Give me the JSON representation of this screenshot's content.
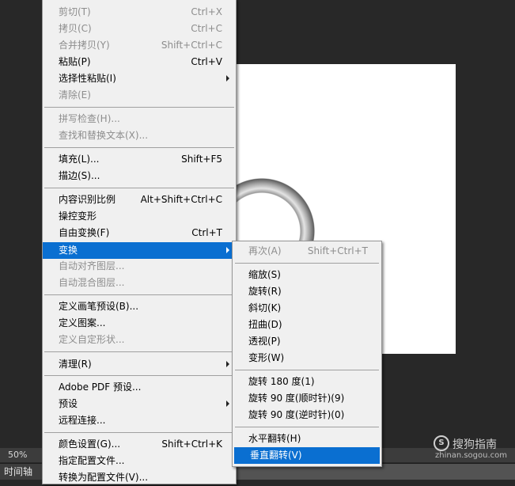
{
  "status": {
    "zoom": "50%"
  },
  "timeline": {
    "tab": "时间轴"
  },
  "watermark": {
    "logo": "S",
    "name": "搜狗指南",
    "url": "zhinan.sogou.com"
  },
  "colors": {
    "highlight": "#0a6fd1",
    "menu_bg": "#f0f0f0",
    "disabled_text": "#8d8d8d",
    "app_bg": "#282828"
  },
  "edit_menu": {
    "items": [
      {
        "label": "剪切(T)",
        "shortcut": "Ctrl+X",
        "disabled": true
      },
      {
        "label": "拷贝(C)",
        "shortcut": "Ctrl+C",
        "disabled": true
      },
      {
        "label": "合并拷贝(Y)",
        "shortcut": "Shift+Ctrl+C",
        "disabled": true
      },
      {
        "label": "粘贴(P)",
        "shortcut": "Ctrl+V"
      },
      {
        "label": "选择性粘贴(I)",
        "submenu": true
      },
      {
        "label": "清除(E)",
        "disabled": true
      },
      {
        "label": "拼写检查(H)...",
        "disabled": true
      },
      {
        "label": "查找和替换文本(X)...",
        "disabled": true
      },
      {
        "label": "填充(L)...",
        "shortcut": "Shift+F5"
      },
      {
        "label": "描边(S)..."
      },
      {
        "label": "内容识别比例",
        "shortcut": "Alt+Shift+Ctrl+C"
      },
      {
        "label": "操控变形"
      },
      {
        "label": "自由变换(F)",
        "shortcut": "Ctrl+T"
      },
      {
        "label": "变换",
        "submenu": true,
        "highlighted": true
      },
      {
        "label": "自动对齐图层...",
        "disabled": true
      },
      {
        "label": "自动混合图层...",
        "disabled": true
      },
      {
        "label": "定义画笔预设(B)..."
      },
      {
        "label": "定义图案..."
      },
      {
        "label": "定义自定形状...",
        "disabled": true
      },
      {
        "label": "清理(R)",
        "submenu": true
      },
      {
        "label": "Adobe PDF 预设..."
      },
      {
        "label": "预设",
        "submenu": true
      },
      {
        "label": "远程连接..."
      },
      {
        "label": "颜色设置(G)...",
        "shortcut": "Shift+Ctrl+K"
      },
      {
        "label": "指定配置文件..."
      },
      {
        "label": "转换为配置文件(V)..."
      }
    ]
  },
  "transform_submenu": {
    "items": [
      {
        "label": "再次(A)",
        "shortcut": "Shift+Ctrl+T",
        "disabled": true
      },
      {
        "label": "缩放(S)"
      },
      {
        "label": "旋转(R)"
      },
      {
        "label": "斜切(K)"
      },
      {
        "label": "扭曲(D)"
      },
      {
        "label": "透视(P)"
      },
      {
        "label": "变形(W)"
      },
      {
        "label": "旋转 180 度(1)"
      },
      {
        "label": "旋转 90 度(顺时针)(9)"
      },
      {
        "label": "旋转 90 度(逆时针)(0)"
      },
      {
        "label": "水平翻转(H)"
      },
      {
        "label": "垂直翻转(V)",
        "highlighted": true
      }
    ]
  }
}
